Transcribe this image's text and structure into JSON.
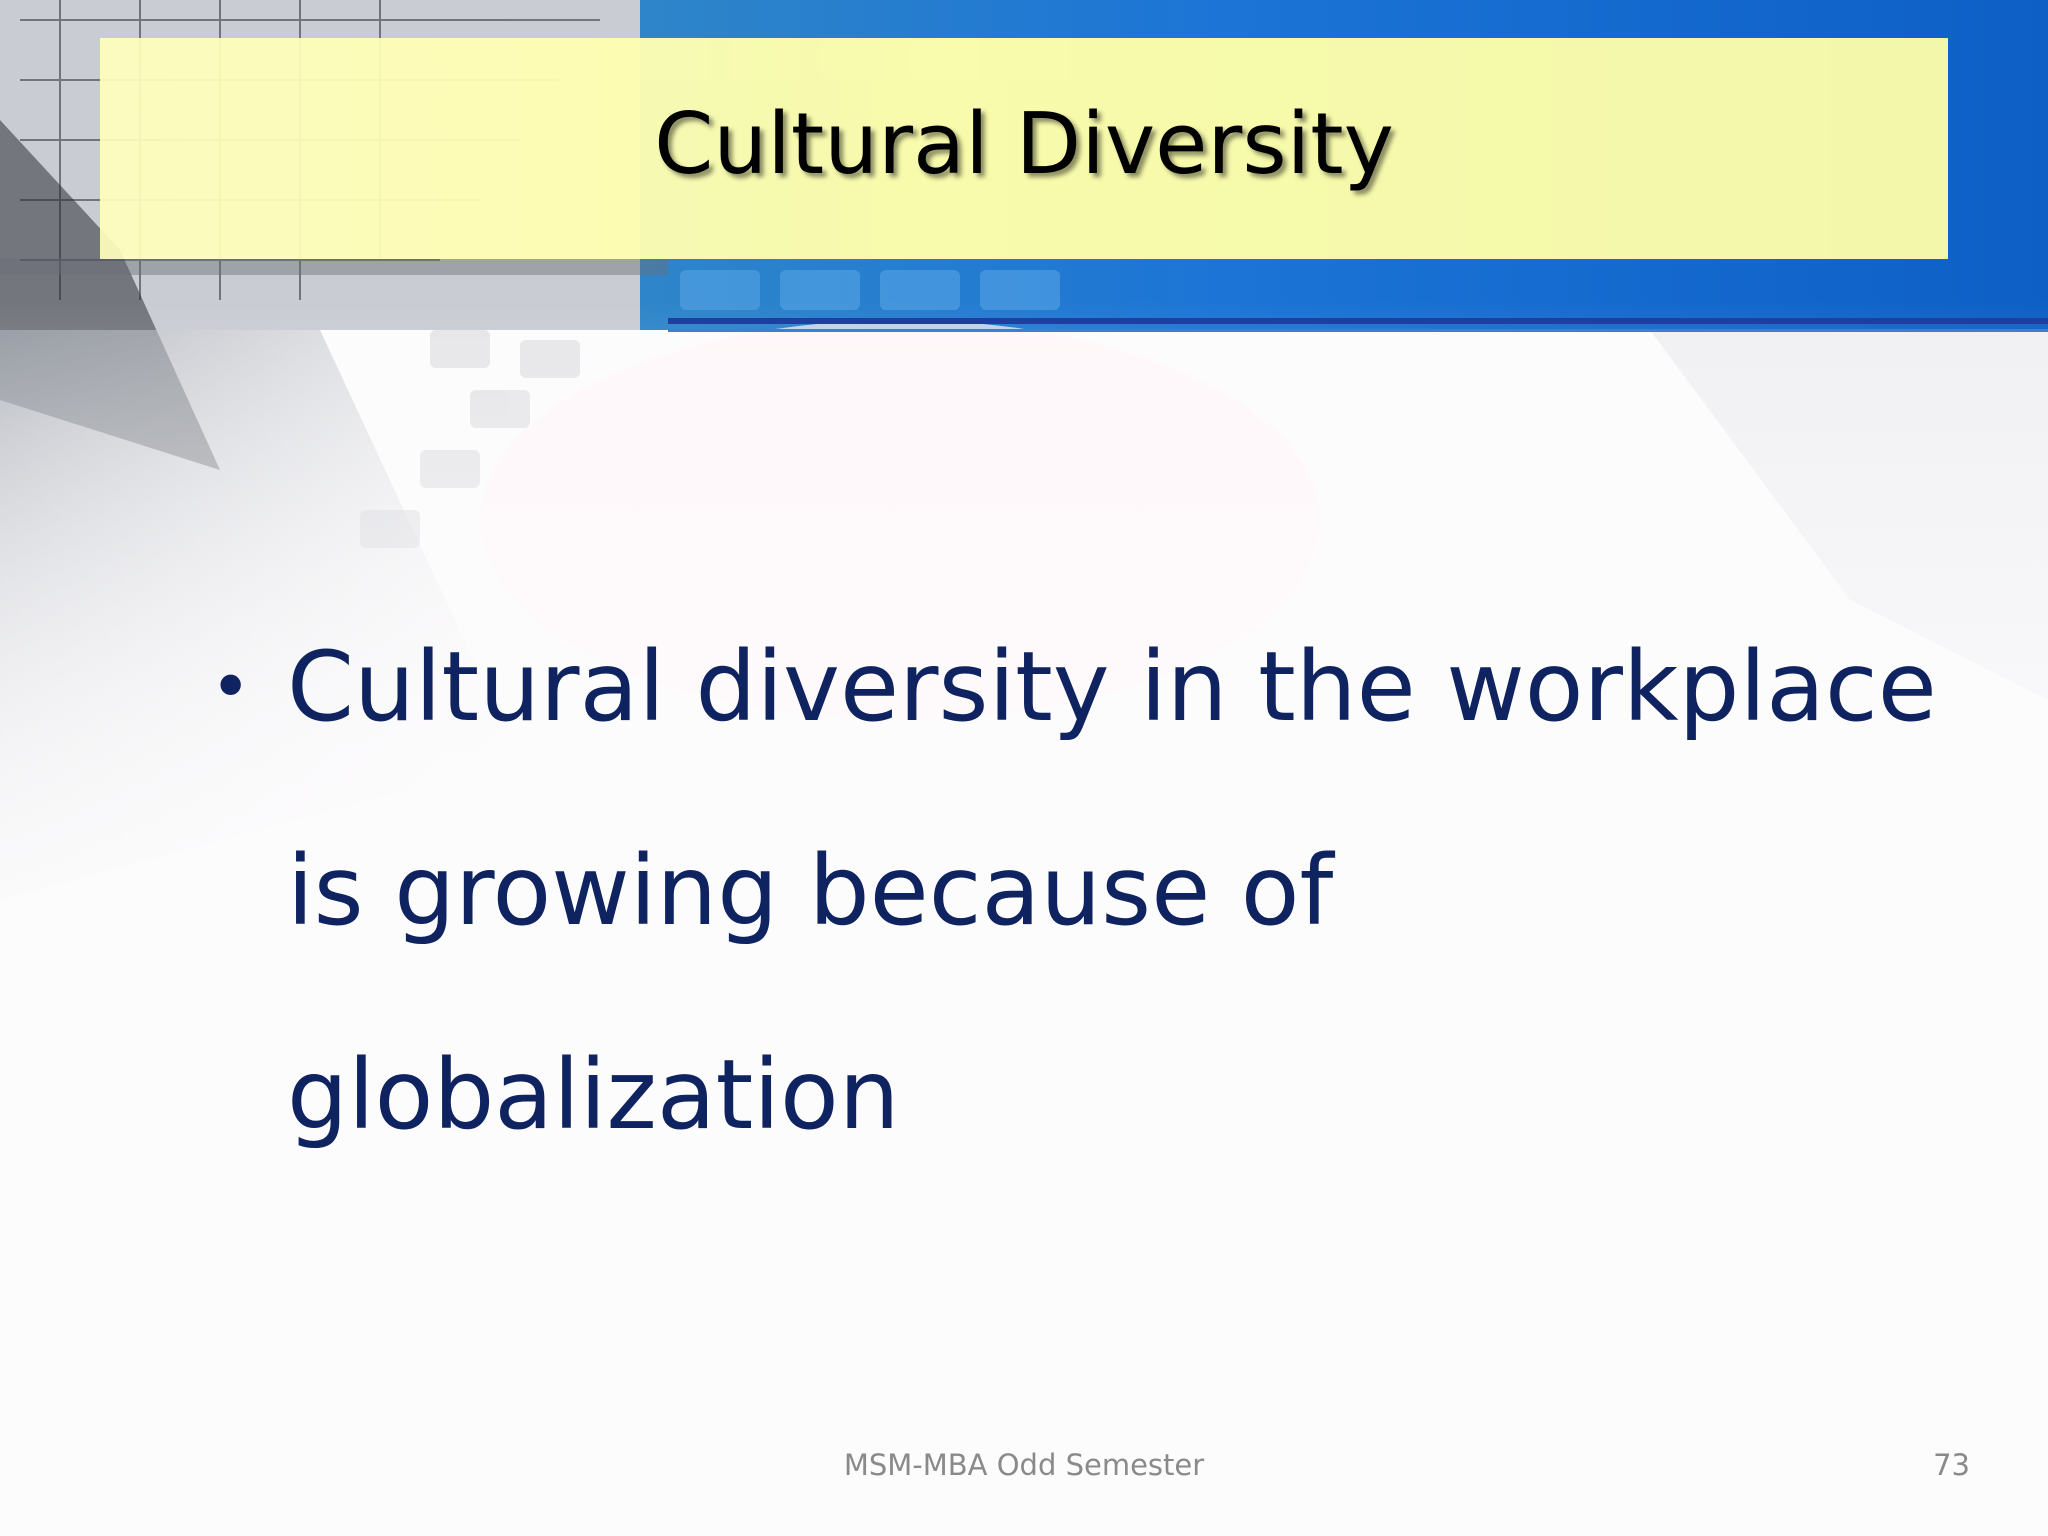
{
  "slide": {
    "title": "Cultural Diversity",
    "bullets": [
      "Cultural diversity in the workplace is growing because of globalization"
    ],
    "bullet_glyph": "•",
    "footer": "MSM-MBA Odd Semester",
    "page_number": "73"
  },
  "colors": {
    "title_band": "#ffffa8",
    "body_text": "#0f2360",
    "accent_blue": "#1f3fa0",
    "banner_blue": "#1a6fd0"
  }
}
